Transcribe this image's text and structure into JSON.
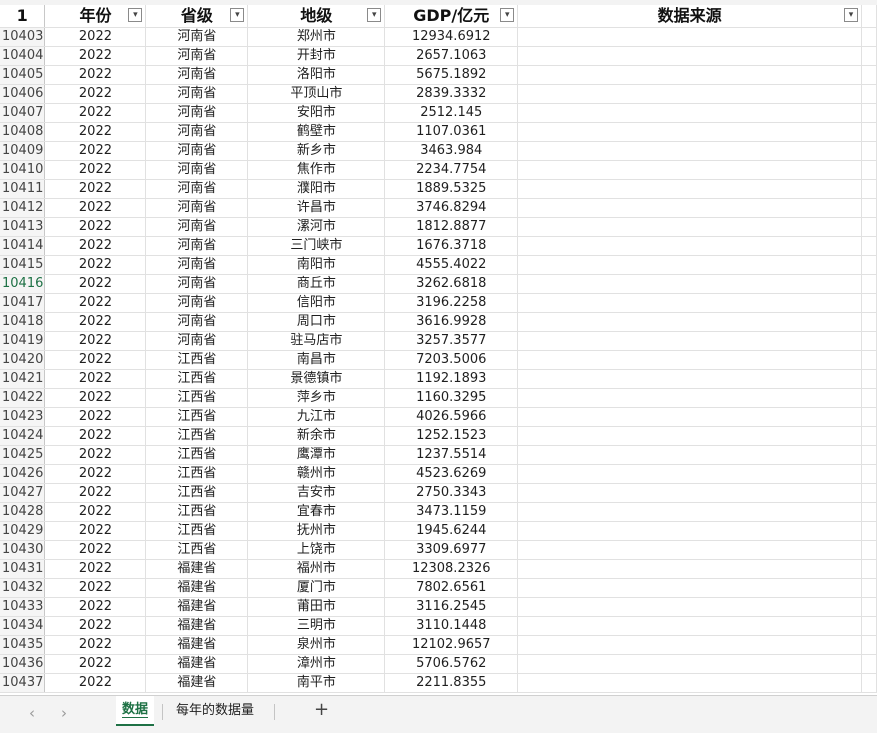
{
  "header": {
    "corner": "1",
    "columns": [
      {
        "label": "年份"
      },
      {
        "label": "省级"
      },
      {
        "label": "地级"
      },
      {
        "label": "GDP/亿元"
      },
      {
        "label": "数据来源"
      }
    ],
    "filter_glyph": "▾"
  },
  "rows": [
    {
      "rn": "10403",
      "year": "2022",
      "prov": "河南省",
      "city": "郑州市",
      "gdp": "12934.6912"
    },
    {
      "rn": "10404",
      "year": "2022",
      "prov": "河南省",
      "city": "开封市",
      "gdp": "2657.1063"
    },
    {
      "rn": "10405",
      "year": "2022",
      "prov": "河南省",
      "city": "洛阳市",
      "gdp": "5675.1892"
    },
    {
      "rn": "10406",
      "year": "2022",
      "prov": "河南省",
      "city": "平顶山市",
      "gdp": "2839.3332"
    },
    {
      "rn": "10407",
      "year": "2022",
      "prov": "河南省",
      "city": "安阳市",
      "gdp": "2512.145"
    },
    {
      "rn": "10408",
      "year": "2022",
      "prov": "河南省",
      "city": "鹤壁市",
      "gdp": "1107.0361"
    },
    {
      "rn": "10409",
      "year": "2022",
      "prov": "河南省",
      "city": "新乡市",
      "gdp": "3463.984"
    },
    {
      "rn": "10410",
      "year": "2022",
      "prov": "河南省",
      "city": "焦作市",
      "gdp": "2234.7754"
    },
    {
      "rn": "10411",
      "year": "2022",
      "prov": "河南省",
      "city": "濮阳市",
      "gdp": "1889.5325"
    },
    {
      "rn": "10412",
      "year": "2022",
      "prov": "河南省",
      "city": "许昌市",
      "gdp": "3746.8294"
    },
    {
      "rn": "10413",
      "year": "2022",
      "prov": "河南省",
      "city": "漯河市",
      "gdp": "1812.8877"
    },
    {
      "rn": "10414",
      "year": "2022",
      "prov": "河南省",
      "city": "三门峡市",
      "gdp": "1676.3718"
    },
    {
      "rn": "10415",
      "year": "2022",
      "prov": "河南省",
      "city": "南阳市",
      "gdp": "4555.4022"
    },
    {
      "rn": "10416",
      "year": "2022",
      "prov": "河南省",
      "city": "商丘市",
      "gdp": "3262.6818"
    },
    {
      "rn": "10417",
      "year": "2022",
      "prov": "河南省",
      "city": "信阳市",
      "gdp": "3196.2258"
    },
    {
      "rn": "10418",
      "year": "2022",
      "prov": "河南省",
      "city": "周口市",
      "gdp": "3616.9928"
    },
    {
      "rn": "10419",
      "year": "2022",
      "prov": "河南省",
      "city": "驻马店市",
      "gdp": "3257.3577"
    },
    {
      "rn": "10420",
      "year": "2022",
      "prov": "江西省",
      "city": "南昌市",
      "gdp": "7203.5006"
    },
    {
      "rn": "10421",
      "year": "2022",
      "prov": "江西省",
      "city": "景德镇市",
      "gdp": "1192.1893"
    },
    {
      "rn": "10422",
      "year": "2022",
      "prov": "江西省",
      "city": "萍乡市",
      "gdp": "1160.3295"
    },
    {
      "rn": "10423",
      "year": "2022",
      "prov": "江西省",
      "city": "九江市",
      "gdp": "4026.5966"
    },
    {
      "rn": "10424",
      "year": "2022",
      "prov": "江西省",
      "city": "新余市",
      "gdp": "1252.1523"
    },
    {
      "rn": "10425",
      "year": "2022",
      "prov": "江西省",
      "city": "鹰潭市",
      "gdp": "1237.5514"
    },
    {
      "rn": "10426",
      "year": "2022",
      "prov": "江西省",
      "city": "赣州市",
      "gdp": "4523.6269"
    },
    {
      "rn": "10427",
      "year": "2022",
      "prov": "江西省",
      "city": "吉安市",
      "gdp": "2750.3343"
    },
    {
      "rn": "10428",
      "year": "2022",
      "prov": "江西省",
      "city": "宜春市",
      "gdp": "3473.1159"
    },
    {
      "rn": "10429",
      "year": "2022",
      "prov": "江西省",
      "city": "抚州市",
      "gdp": "1945.6244"
    },
    {
      "rn": "10430",
      "year": "2022",
      "prov": "江西省",
      "city": "上饶市",
      "gdp": "3309.6977"
    },
    {
      "rn": "10431",
      "year": "2022",
      "prov": "福建省",
      "city": "福州市",
      "gdp": "12308.2326"
    },
    {
      "rn": "10432",
      "year": "2022",
      "prov": "福建省",
      "city": "厦门市",
      "gdp": "7802.6561"
    },
    {
      "rn": "10433",
      "year": "2022",
      "prov": "福建省",
      "city": "莆田市",
      "gdp": "3116.2545"
    },
    {
      "rn": "10434",
      "year": "2022",
      "prov": "福建省",
      "city": "三明市",
      "gdp": "3110.1448"
    },
    {
      "rn": "10435",
      "year": "2022",
      "prov": "福建省",
      "city": "泉州市",
      "gdp": "12102.9657"
    },
    {
      "rn": "10436",
      "year": "2022",
      "prov": "福建省",
      "city": "漳州市",
      "gdp": "5706.5762"
    },
    {
      "rn": "10437",
      "year": "2022",
      "prov": "福建省",
      "city": "南平市",
      "gdp": "2211.8355"
    }
  ],
  "selected_row": "10416",
  "tabs": {
    "prev": "‹",
    "next": "›",
    "items": [
      {
        "label": "数据",
        "active": true
      },
      {
        "label": "每年的数据量",
        "active": false
      }
    ],
    "add": "+"
  },
  "colors": {
    "accent": "#1e7145",
    "grid": "#e1e1e1",
    "header_bg": "#f5f5f5"
  }
}
